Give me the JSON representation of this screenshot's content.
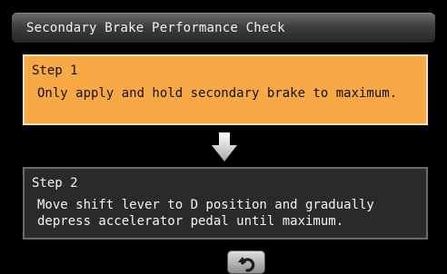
{
  "header": {
    "title": "Secondary Brake Performance Check"
  },
  "steps": [
    {
      "heading": "Step 1",
      "body": "Only apply and hold secondary brake to maximum."
    },
    {
      "heading": "Step 2",
      "body_line1": "Move shift lever to D position and gradually",
      "body_line2": "depress accelerator pedal until maximum."
    }
  ],
  "icons": {
    "arrow": "down-arrow-icon",
    "back": "return-arrow-icon"
  },
  "colors": {
    "active_step": "#f8a945",
    "inactive_step": "#2a2a2a",
    "background": "#000000"
  }
}
